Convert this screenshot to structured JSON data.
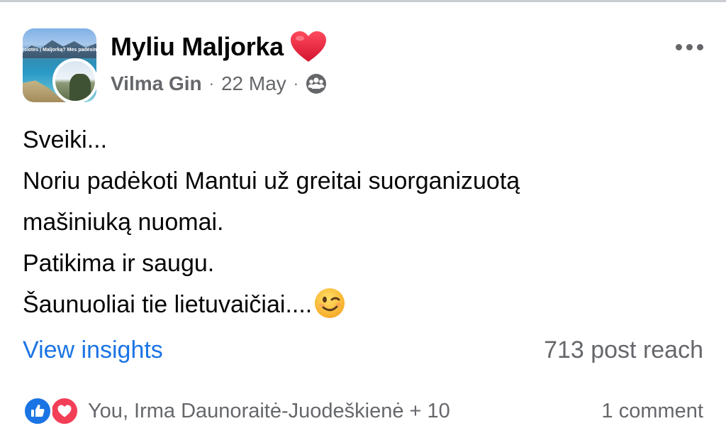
{
  "post": {
    "group_name": "Myliu Maljorka",
    "group_avatar_banner": "Įsiotės į Maljorką? Mes padėsime",
    "author": "Vilma Gin",
    "separator": "·",
    "date": "22 May",
    "body_lines": [
      "Sveiki...",
      "Noriu padėkoti Mantui už greitai suorganizuotą",
      "mašiniuką nuomai.",
      "Patikima ir saugu.",
      "Šaunuoliai tie lietuvaičiai...."
    ],
    "insights_label": "View insights",
    "reach": "713 post reach",
    "reactors": "You, Irma Daunoraitė-Juodeškienė + 10",
    "comments": "1 comment"
  },
  "icons": {
    "title_icon": "red-heart-icon",
    "privacy": "group-members-icon",
    "more": "more-options-icon",
    "emoji": "winking-face-icon",
    "reactions": [
      "like-reaction-icon",
      "love-reaction-icon"
    ]
  },
  "colors": {
    "link_blue": "#1b74e4",
    "secondary_text": "#65676b",
    "like_blue": "#1b74e4",
    "love_red": "#f33e58",
    "heart_red": "#e0245e"
  }
}
